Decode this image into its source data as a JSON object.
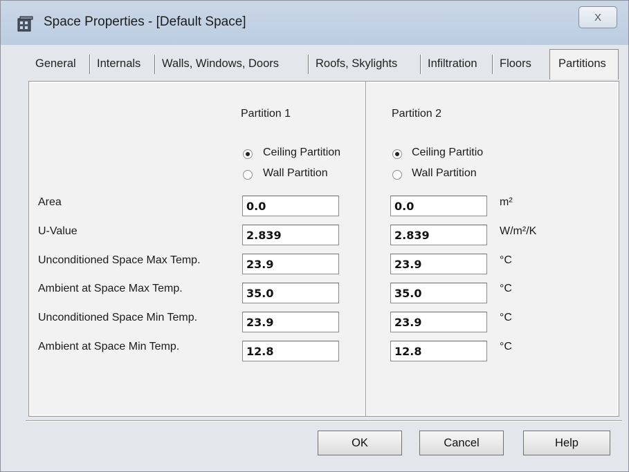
{
  "window": {
    "title": "Space Properties - [Default Space]",
    "close_glyph": "X"
  },
  "tabs": [
    {
      "label": "General"
    },
    {
      "label": "Internals"
    },
    {
      "label": "Walls, Windows, Doors"
    },
    {
      "label": "Roofs, Skylights"
    },
    {
      "label": "Infiltration"
    },
    {
      "label": "Floors"
    },
    {
      "label": "Partitions",
      "active": true
    }
  ],
  "partitions": [
    {
      "header": "Partition 1",
      "ceiling_label": "Ceiling Partition",
      "wall_label": "Wall Partition",
      "selected": "ceiling",
      "values": {
        "area": "0.0",
        "u_value": "2.839",
        "unc_max": "23.9",
        "amb_max": "35.0",
        "unc_min": "23.9",
        "amb_min": "12.8"
      }
    },
    {
      "header": "Partition 2",
      "ceiling_label": "Ceiling Partitio",
      "wall_label": "Wall Partition",
      "selected": "ceiling",
      "values": {
        "area": "0.0",
        "u_value": "2.839",
        "unc_max": "23.9",
        "amb_max": "35.0",
        "unc_min": "23.9",
        "amb_min": "12.8"
      }
    }
  ],
  "rows": {
    "area": "Area",
    "u_value": "U-Value",
    "unc_max": "Unconditioned Space Max Temp.",
    "amb_max": "Ambient at Space Max Temp.",
    "unc_min": "Unconditioned Space Min Temp.",
    "amb_min": "Ambient at Space Min Temp."
  },
  "units": {
    "area": "m²",
    "u_value": "W/m²/K",
    "temp": "°C"
  },
  "buttons": {
    "ok": "OK",
    "cancel": "Cancel",
    "help": "Help"
  }
}
